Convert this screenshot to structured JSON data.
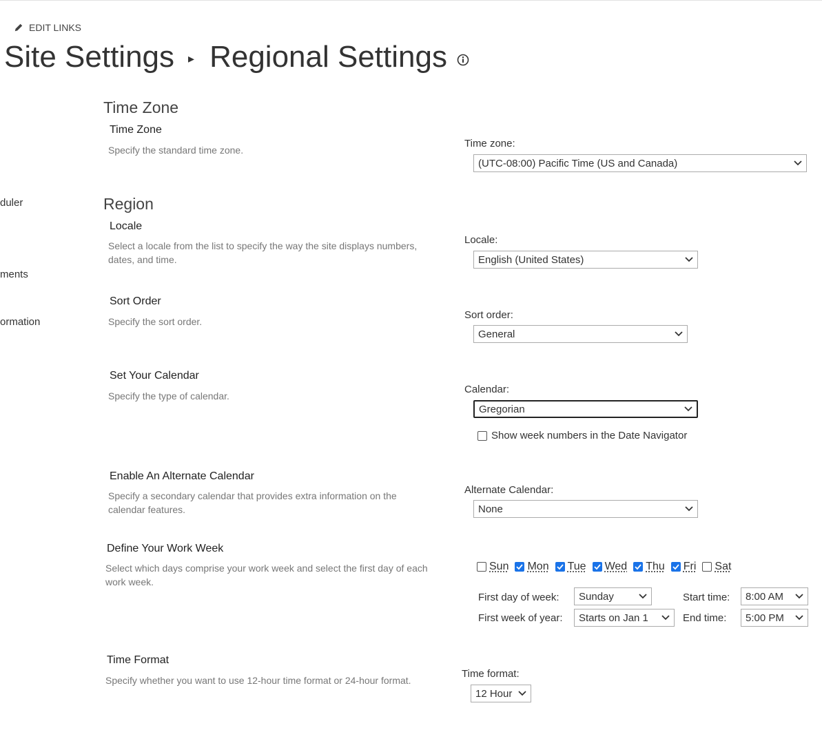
{
  "header": {
    "edit_links": "EDIT LINKS",
    "breadcrumb_parent": "Site Settings",
    "breadcrumb_separator": "▸",
    "page_title": "Regional Settings"
  },
  "nav": {
    "items": [
      "duler",
      "ments",
      "ormation"
    ]
  },
  "sections": {
    "time_zone_heading": "Time Zone",
    "region_heading": "Region"
  },
  "time_zone": {
    "title": "Time Zone",
    "description": "Specify the standard time zone.",
    "label": "Time zone:",
    "value": "(UTC-08:00) Pacific Time (US and Canada)"
  },
  "locale": {
    "title": "Locale",
    "description": "Select a locale from the list to specify the way the site displays numbers, dates, and time.",
    "label": "Locale:",
    "value": "English (United States)"
  },
  "sort_order": {
    "title": "Sort Order",
    "description": "Specify the sort order.",
    "label": "Sort order:",
    "value": "General"
  },
  "calendar": {
    "title": "Set Your Calendar",
    "description": "Specify the type of calendar.",
    "label": "Calendar:",
    "value": "Gregorian",
    "week_numbers_label": "Show week numbers in the Date Navigator",
    "week_numbers_checked": false
  },
  "alternate_calendar": {
    "title": "Enable An Alternate Calendar",
    "description": "Specify a secondary calendar that provides extra information on the calendar features.",
    "label": "Alternate Calendar:",
    "value": "None"
  },
  "work_week": {
    "title": "Define Your Work Week",
    "description": "Select which days comprise your work week and select the first day of each work week.",
    "days": [
      {
        "label": "Sun",
        "checked": false
      },
      {
        "label": "Mon",
        "checked": true
      },
      {
        "label": "Tue",
        "checked": true
      },
      {
        "label": "Wed",
        "checked": true
      },
      {
        "label": "Thu",
        "checked": true
      },
      {
        "label": "Fri",
        "checked": true
      },
      {
        "label": "Sat",
        "checked": false
      }
    ],
    "first_day_label": "First day of week:",
    "first_day_value": "Sunday",
    "first_week_label": "First week of year:",
    "first_week_value": "Starts on Jan 1",
    "start_time_label": "Start time:",
    "start_time_value": "8:00 AM",
    "end_time_label": "End time:",
    "end_time_value": "5:00 PM"
  },
  "time_format": {
    "title": "Time Format",
    "description": "Specify whether you want to use 12-hour time format or 24-hour format.",
    "label": "Time format:",
    "value": "12 Hour"
  },
  "colors": {
    "checkbox_accent": "#1a73e8",
    "description_text": "#777777"
  }
}
